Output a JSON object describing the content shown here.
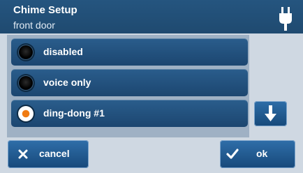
{
  "header": {
    "title": "Chime Setup",
    "subtitle": "front door",
    "right_icon": "plug-icon"
  },
  "options": [
    {
      "label": "disabled",
      "selected": false
    },
    {
      "label": "voice only",
      "selected": false
    },
    {
      "label": "ding-dong #1",
      "selected": true
    }
  ],
  "scroll": {
    "down_icon": "arrow-down-icon"
  },
  "footer": {
    "cancel_label": "cancel",
    "cancel_icon": "close-icon",
    "ok_label": "ok",
    "ok_icon": "checkmark-icon"
  },
  "colors": {
    "header": "#1f4a70",
    "button": "#1c4670",
    "selected": "#f07b12",
    "panel": "#cfd8e2"
  }
}
